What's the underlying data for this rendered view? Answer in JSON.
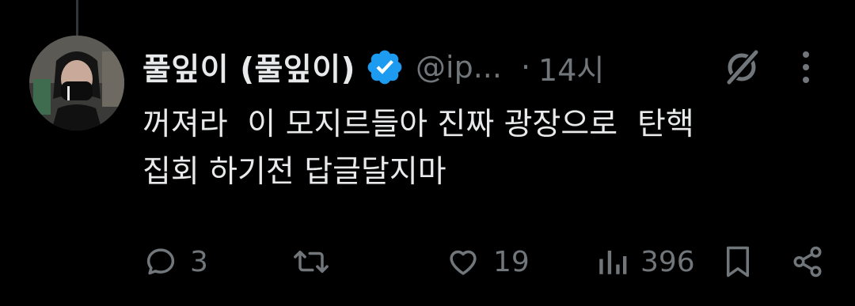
{
  "tweet": {
    "display_name": "풀잎이 (풀잎이)",
    "handle": "@ip...",
    "separator": "·",
    "time": "14시",
    "text_lines": [
      "꺼져라  이 모지르들아 진짜 광장으로  탄핵",
      "집회 하기전 답글달지마"
    ]
  },
  "actions": {
    "replies": "3",
    "retweets": "",
    "likes": "19",
    "views": "396"
  },
  "icons": {
    "verified": "verified-badge-icon",
    "grok": "grok-icon",
    "more": "more-vertical-icon",
    "reply": "reply-icon",
    "retweet": "retweet-icon",
    "like": "heart-icon",
    "views": "views-icon",
    "bookmark": "bookmark-icon",
    "share": "share-icon"
  },
  "colors": {
    "background": "#000000",
    "text_primary": "#e7e9ea",
    "text_secondary": "#71767b",
    "verified_blue": "#1d9bf0",
    "thread_line": "#333639"
  }
}
